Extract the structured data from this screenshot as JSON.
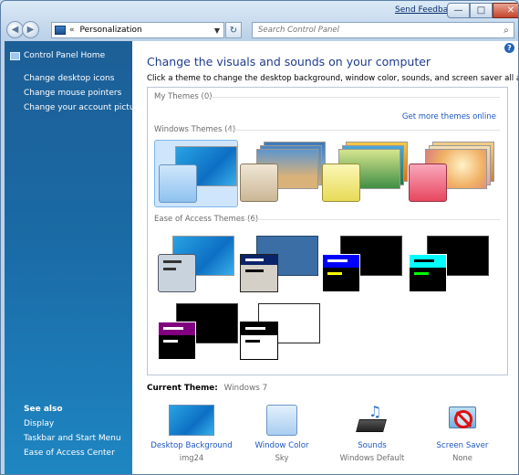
{
  "window": {
    "send_feedback": "Send Feedback",
    "minimize": "—",
    "maximize": "□",
    "close": "✕"
  },
  "address": {
    "chevron": "«",
    "breadcrumb": "Personalization",
    "search_placeholder": "Search Control Panel"
  },
  "sidebar": {
    "home": "Control Panel Home",
    "links": [
      "Change desktop icons",
      "Change mouse pointers",
      "Change your account picture"
    ],
    "see_also_title": "See also",
    "see_also": [
      "Display",
      "Taskbar and Start Menu",
      "Ease of Access Center"
    ]
  },
  "main": {
    "title": "Change the visuals and sounds on your computer",
    "subtitle": "Click a theme to change the desktop background, window color, sounds, and screen saver all at once.",
    "my_themes_label": "My Themes (0)",
    "get_more_link": "Get more themes online",
    "windows_themes_label": "Windows Themes (4)",
    "ease_themes_label": "Ease of Access Themes (6)",
    "current_theme_label": "Current Theme:",
    "current_theme_name": "Windows 7"
  },
  "bottom": {
    "desktop_background": {
      "label": "Desktop Background",
      "value": "img24"
    },
    "window_color": {
      "label": "Window Color",
      "value": "Sky"
    },
    "sounds": {
      "label": "Sounds",
      "value": "Windows Default"
    },
    "screen_saver": {
      "label": "Screen Saver",
      "value": "None"
    }
  },
  "colors": {
    "accent_link": "#1a56c5",
    "heading": "#1f3c8e",
    "sidebar_top": "#1d5f97",
    "sidebar_bottom": "#1e86c2"
  }
}
